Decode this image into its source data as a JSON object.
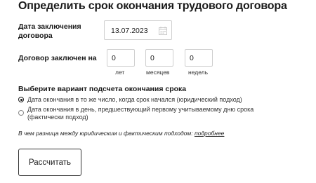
{
  "title": "Определить срок окончания трудового договора",
  "conclusion_date": {
    "label_line1": "Дата заключения",
    "label_line2": "договора",
    "value": "13.07.2023",
    "icon": "calendar-icon"
  },
  "duration": {
    "label": "Договор заключен на",
    "fields": [
      {
        "value": "0",
        "unit": "лет"
      },
      {
        "value": "0",
        "unit": "месяцев"
      },
      {
        "value": "0",
        "unit": "недель"
      }
    ]
  },
  "calc_variant": {
    "label": "Выберите вариант подсчета окончания срока",
    "options": [
      {
        "text": "Дата окончания в то же число, когда срок начался (юридический подход)",
        "checked": true
      },
      {
        "text": "Дата окончания в день, предшествующий первому учитываемому дню срока (фактически подход)",
        "checked": false
      }
    ]
  },
  "hint": {
    "text": "В чем разница между юридическим и фактическим подходом: ",
    "link": "подробнее"
  },
  "submit_label": "Рассчитать"
}
